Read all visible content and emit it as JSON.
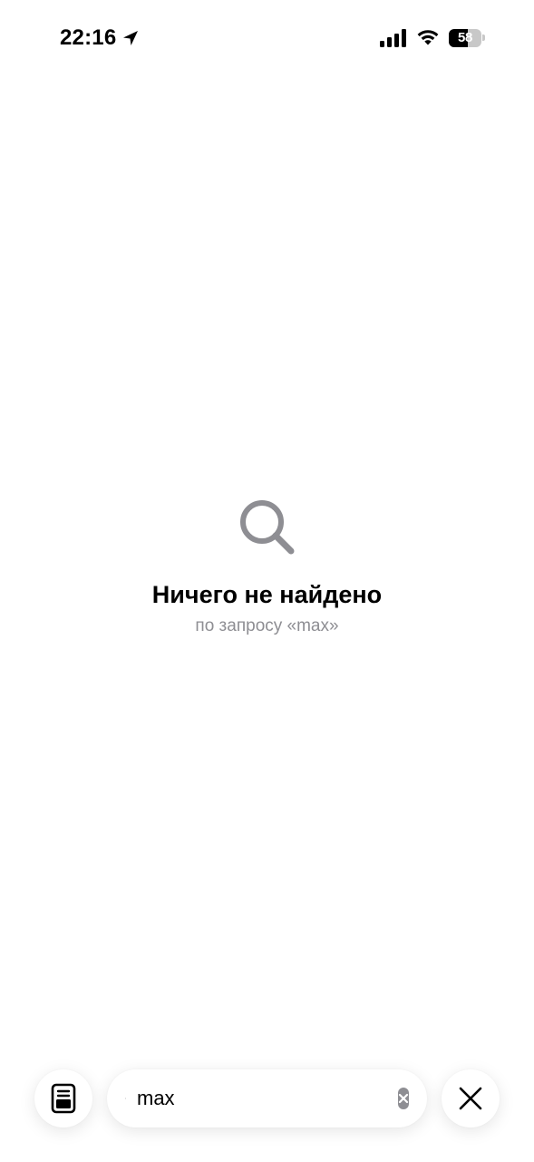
{
  "status_bar": {
    "time": "22:16",
    "battery_level": "58",
    "battery_fraction": 0.58,
    "icons": [
      "location-arrow-icon",
      "cellular-signal-icon",
      "wifi-icon",
      "battery-icon"
    ]
  },
  "empty_state": {
    "icon": "search-icon",
    "title": "Ничего не найдено",
    "subtitle": "по запросу «max»"
  },
  "toolbar": {
    "reader_icon": "reader-mode-icon",
    "search_icon": "search-icon",
    "search_value": "max",
    "clear_icon": "clear-circle-icon",
    "close_icon": "close-icon"
  },
  "colors": {
    "background": "#ffffff",
    "text_primary": "#000000",
    "text_secondary": "#8e8e93",
    "icon_gray": "#8e8e93"
  }
}
